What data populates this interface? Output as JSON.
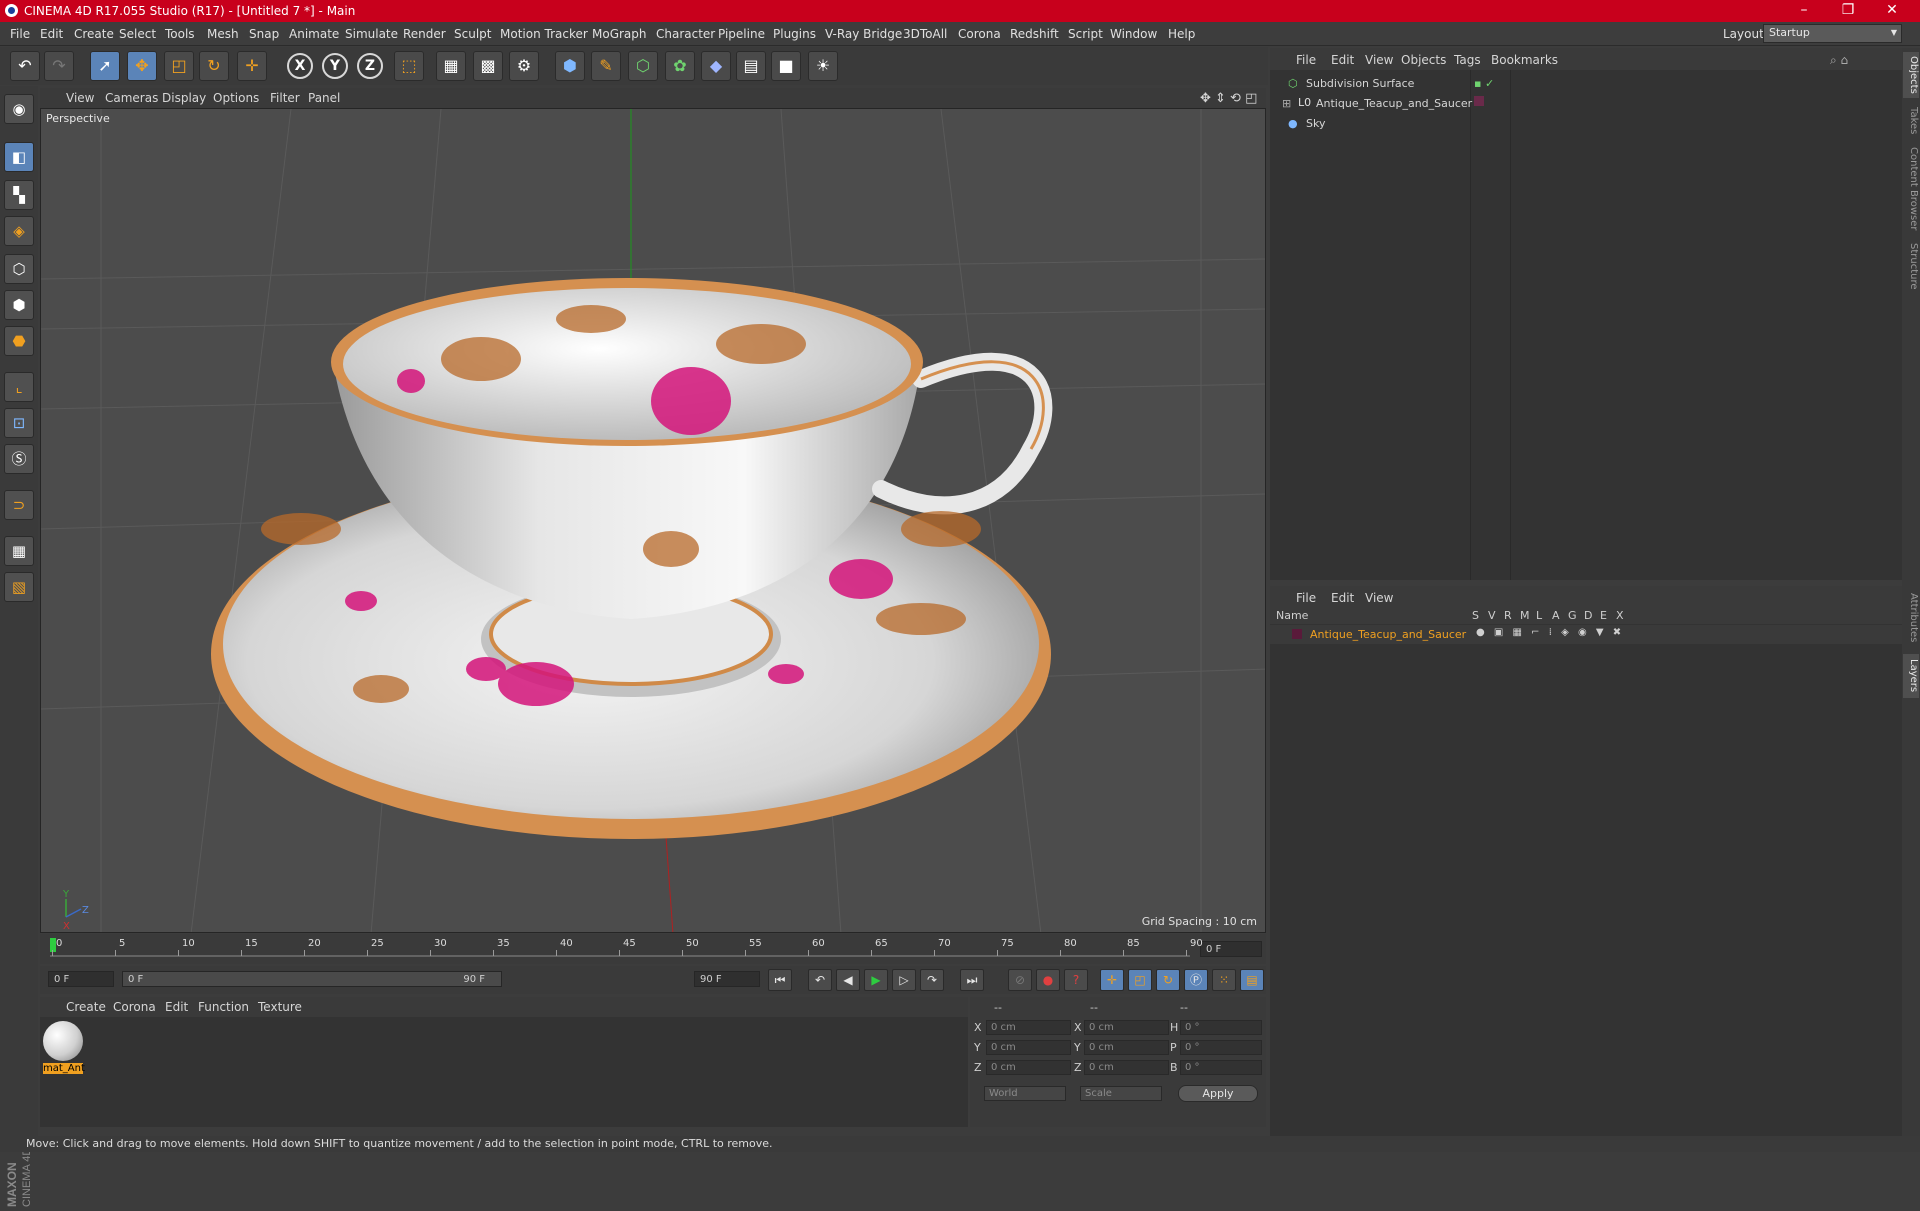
{
  "window": {
    "title": "CINEMA 4D R17.055 Studio (R17) - [Untitled 7 *] - Main",
    "controls": [
      "–",
      "❐",
      "✕"
    ]
  },
  "menubar": {
    "items": [
      "File",
      "Edit",
      "Create",
      "Select",
      "Tools",
      "Mesh",
      "Snap",
      "Animate",
      "Simulate",
      "Render",
      "Sculpt",
      "Motion Tracker",
      "MoGraph",
      "Character",
      "Pipeline",
      "Plugins",
      "V-Ray Bridge",
      "3DToAll",
      "Corona",
      "Redshift",
      "Script",
      "Window",
      "Help"
    ],
    "layout_label": "Layout:",
    "layout_value": "Startup"
  },
  "toolbar": {
    "icons": [
      "undo-icon",
      "redo-icon",
      "select-arrow-icon",
      "move-icon",
      "scale-icon",
      "rotate-icon",
      "recent-tool-icon",
      "x-axis-icon",
      "y-axis-icon",
      "z-axis-icon",
      "world-coord-icon",
      "render-view-icon",
      "render-picture-queue-icon",
      "edit-render-settings-icon",
      "cube-primitive-icon",
      "pen-spline-icon",
      "subdivision-icon",
      "cloner-icon",
      "deformer-icon",
      "floor-icon",
      "camera-icon",
      "light-icon"
    ],
    "axis_labels": [
      "X",
      "Y",
      "Z"
    ]
  },
  "viewport": {
    "menu": [
      "View",
      "Cameras",
      "Display",
      "Options",
      "Filter",
      "Panel"
    ],
    "label": "Perspective",
    "grid_spacing": "Grid Spacing : 10 cm",
    "axis_labels": [
      "Y",
      "Z",
      "X"
    ]
  },
  "timeline": {
    "ticks": [
      "0",
      "5",
      "10",
      "15",
      "20",
      "25",
      "30",
      "35",
      "40",
      "45",
      "50",
      "55",
      "60",
      "65",
      "70",
      "75",
      "80",
      "85",
      "90"
    ],
    "current_frame": "0 F"
  },
  "transport": {
    "start_field": "0 F",
    "range_start": "0 F",
    "range_end": "90 F",
    "end_field": "90 F"
  },
  "material_manager": {
    "menu": [
      "Create",
      "Corona",
      "Edit",
      "Function",
      "Texture"
    ],
    "materials": [
      {
        "name": "mat_Ant"
      }
    ]
  },
  "coordinates": {
    "headers": [
      "--",
      "--",
      "--"
    ],
    "rows": [
      {
        "l1": "X",
        "v1": "0 cm",
        "l2": "X",
        "v2": "0 cm",
        "l3": "H",
        "v3": "0 °"
      },
      {
        "l1": "Y",
        "v1": "0 cm",
        "l2": "Y",
        "v2": "0 cm",
        "l3": "P",
        "v3": "0 °"
      },
      {
        "l1": "Z",
        "v1": "0 cm",
        "l2": "Z",
        "v2": "0 cm",
        "l3": "B",
        "v3": "0 °"
      }
    ],
    "mode1": "World",
    "mode2": "Scale",
    "apply_label": "Apply"
  },
  "object_manager": {
    "menu": [
      "File",
      "Edit",
      "View",
      "Objects",
      "Tags",
      "Bookmarks"
    ],
    "objects": [
      {
        "name": "Subdivision Surface",
        "icon": "subdivision-icon"
      },
      {
        "name": "Antique_Teacup_and_Saucer",
        "icon": "lod-object-icon"
      },
      {
        "name": "Sky",
        "icon": "sky-icon"
      }
    ]
  },
  "layer_manager": {
    "menu": [
      "File",
      "Edit",
      "View"
    ],
    "column_name": "Name",
    "columns": [
      "S",
      "V",
      "R",
      "M",
      "L",
      "A",
      "G",
      "D",
      "E",
      "X"
    ],
    "layers": [
      {
        "name": "Antique_Teacup_and_Saucer",
        "color": "#f0a020"
      }
    ]
  },
  "side_tabs": [
    "Objects",
    "Takes",
    "Content Browser",
    "Structure",
    "Attributes",
    "Layers"
  ],
  "status_bar": {
    "text": "Move: Click and drag to move elements. Hold down SHIFT to quantize movement / add to the selection in point mode, CTRL to remove."
  },
  "branding": {
    "logo": "MAXON CINEMA 4D"
  },
  "colors": {
    "titlebar": "#c8001c",
    "accent_orange": "#f0a020",
    "active_tool": "#5b84b8"
  }
}
